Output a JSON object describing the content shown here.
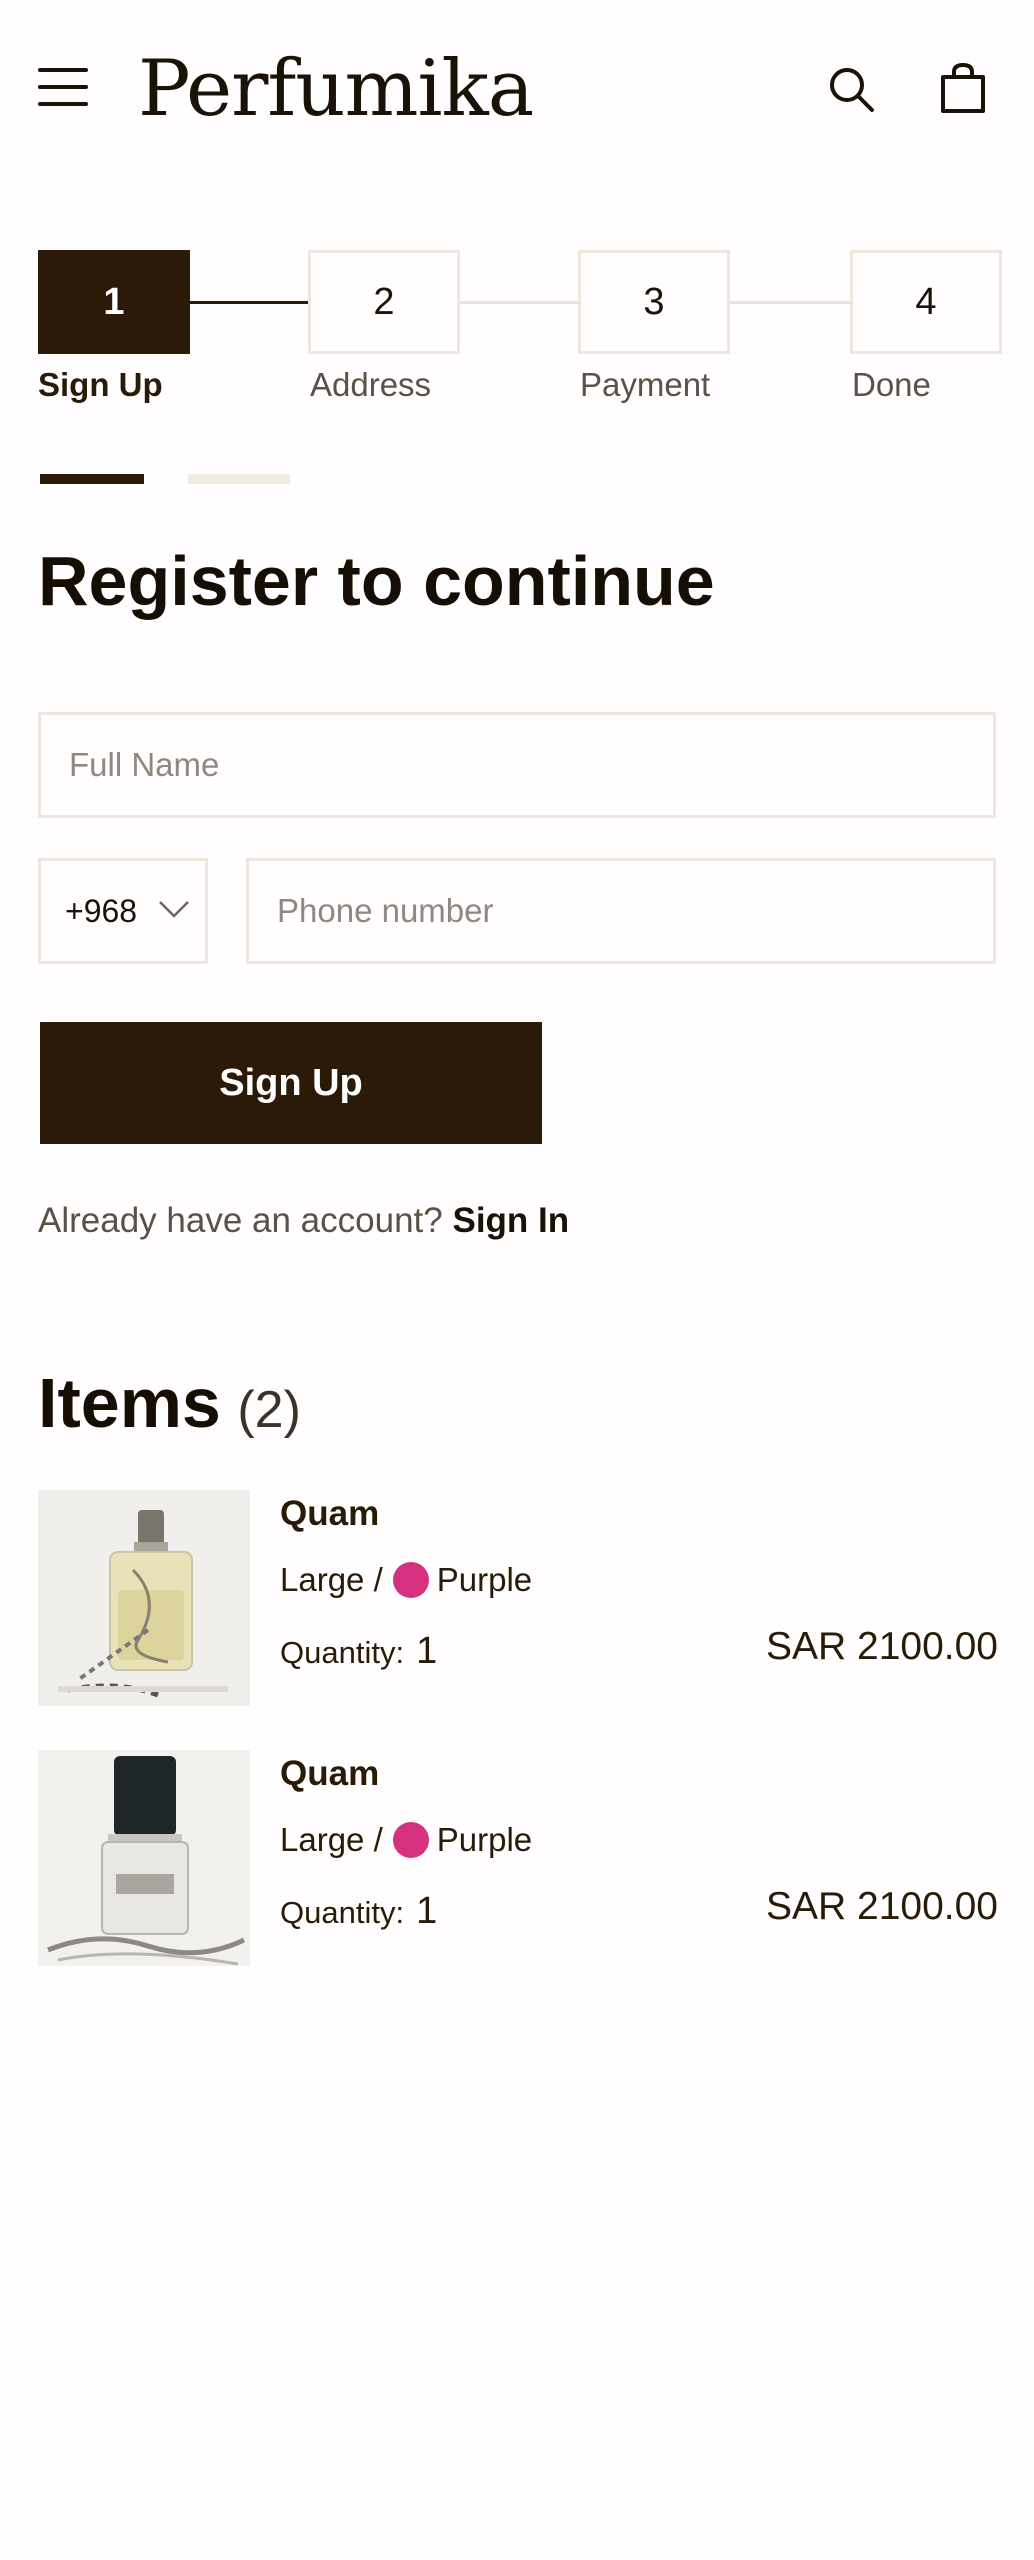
{
  "header": {
    "logo": "Perfumika",
    "menu_icon": "hamburger-menu-icon",
    "search_icon": "search-icon",
    "cart_icon": "shopping-bag-icon"
  },
  "stepper": {
    "steps": [
      {
        "number": "1",
        "label": "Sign Up",
        "active": true
      },
      {
        "number": "2",
        "label": "Address",
        "active": false
      },
      {
        "number": "3",
        "label": "Payment",
        "active": false
      },
      {
        "number": "4",
        "label": "Done",
        "active": false
      }
    ]
  },
  "form": {
    "title": "Register to continue",
    "full_name_placeholder": "Full Name",
    "full_name_value": "",
    "country_code": "+968",
    "phone_placeholder": "Phone number",
    "phone_value": "",
    "submit_label": "Sign Up",
    "account_prompt": "Already have an account?",
    "signin_label": "Sign In"
  },
  "items": {
    "title": "Items",
    "count": "(2)",
    "list": [
      {
        "name": "Quam",
        "size": "Large /",
        "color_name": "Purple",
        "color": "#d6317f",
        "quantity_label": "Quantity:",
        "quantity": "1",
        "price": "SAR 2100.00"
      },
      {
        "name": "Quam",
        "size": "Large /",
        "color_name": "Purple",
        "color": "#d6317f",
        "quantity_label": "Quantity:",
        "quantity": "1",
        "price": "SAR 2100.00"
      }
    ]
  },
  "colors": {
    "primary": "#2b1a07",
    "border": "#ece8df",
    "swatch_purple": "#d6317f"
  }
}
